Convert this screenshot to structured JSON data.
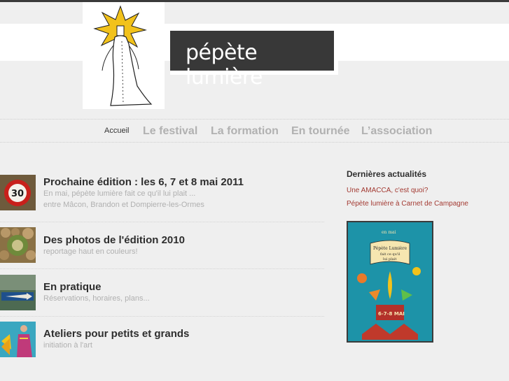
{
  "site": {
    "title": "pépète lumière"
  },
  "nav": {
    "items": [
      {
        "label": "Accueil",
        "active": true
      },
      {
        "label": "Le festival"
      },
      {
        "label": "La formation"
      },
      {
        "label": "En tournée"
      },
      {
        "label": "L’association"
      }
    ]
  },
  "entries": [
    {
      "title": "Prochaine édition : les 6, 7 et 8 mai 2011",
      "lines": [
        "En mai, pépète lumière fait ce qu'il lui plait ...",
        "entre Mâcon, Brandon et Dompierre-les-Ormes"
      ],
      "thumb": "speed-sign-30"
    },
    {
      "title": "Des photos de l'édition 2010",
      "lines": [
        "reportage haut en couleurs!"
      ],
      "thumb": "photo-logs"
    },
    {
      "title": "En pratique",
      "lines": [
        "Réservations, horaires, plans..."
      ],
      "thumb": "direction-sign"
    },
    {
      "title": "Ateliers pour petits et grands",
      "lines": [
        "initiation à l'art"
      ],
      "thumb": "painted-figure"
    }
  ],
  "sidebar": {
    "title": "Dernières actualités",
    "links": [
      "Une AMACCA, c'est quoi?",
      "Pépète lumière à Carnet de Campagne"
    ],
    "poster": {
      "lines": [
        "en mai",
        "Pépète Lumière",
        "fait ce qu'il",
        "lui plait",
        "6-7-8 MAI"
      ]
    }
  },
  "colors": {
    "background": "#efefef",
    "title_box": "#383838",
    "link": "#a33a32",
    "nav_inactive": "#b1b1b1"
  }
}
